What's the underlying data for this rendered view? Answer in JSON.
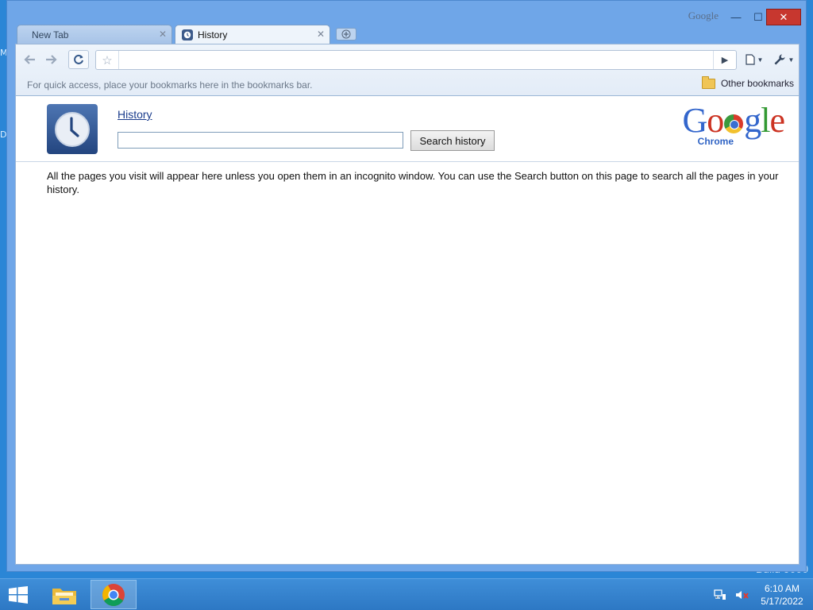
{
  "desktop": {
    "edge_glyphs": [
      "M",
      "D"
    ],
    "build_text": "Build 9000"
  },
  "window": {
    "caption_brand": "Google",
    "controls": {
      "minimize": "—",
      "maximize": "☐",
      "close": "✕"
    }
  },
  "tabs": [
    {
      "label": "New Tab",
      "active": false
    },
    {
      "label": "History",
      "active": true
    }
  ],
  "toolbar": {
    "url_value": "",
    "bookmarks_hint": "For quick access, place your bookmarks here in the bookmarks bar.",
    "other_bookmarks": "Other bookmarks"
  },
  "page": {
    "heading_link": "History",
    "search_value": "",
    "search_button": "Search history",
    "logo_google": "Google",
    "logo_product": "Chrome",
    "info_text": "All the pages you visit will appear here unless you open them in an incognito window. You can use the Search button on this page to search all the pages in your history."
  },
  "taskbar": {
    "time": "6:10 AM",
    "date": "5/17/2022"
  },
  "colors": {
    "desktop": "#2b86d6",
    "link": "#1a3c8c",
    "close_button": "#c7372f"
  }
}
